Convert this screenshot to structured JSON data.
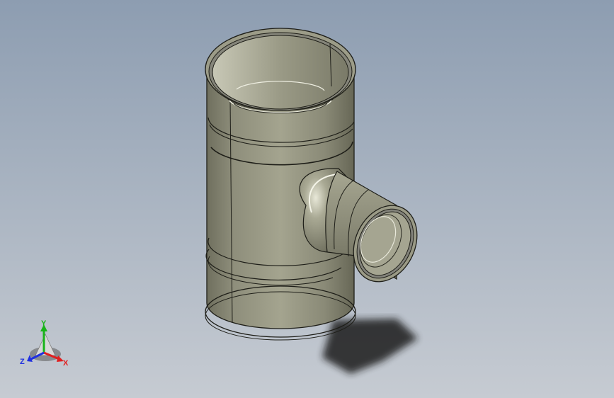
{
  "viewport": {
    "background_top": "#8d9db1",
    "background_bottom": "#c6cbd2"
  },
  "model": {
    "part": "reducing-tee-fitting",
    "body_color": "#8f8f7c",
    "edge_color": "#1e1e18"
  },
  "triad": {
    "y_label": "Y",
    "x_label": "X",
    "z_label": "Z",
    "y_color": "#18b418",
    "x_color": "#e02020",
    "z_color": "#2030e0"
  }
}
